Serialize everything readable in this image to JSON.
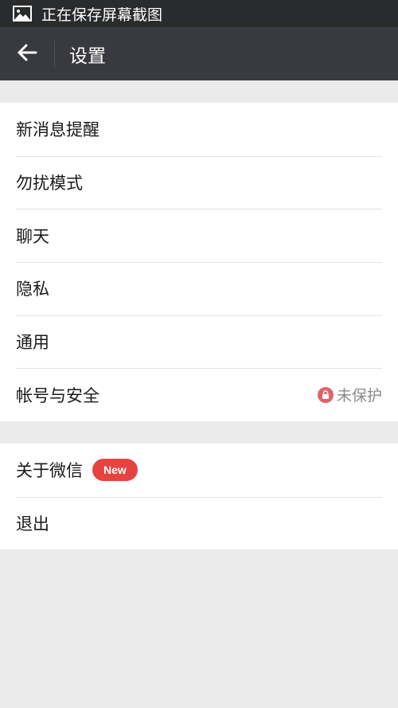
{
  "status_bar": {
    "icon": "image-icon",
    "text": "正在保存屏幕截图"
  },
  "title_bar": {
    "back_icon": "arrow-left-icon",
    "title": "设置"
  },
  "groups": [
    {
      "items": [
        {
          "label": "新消息提醒"
        },
        {
          "label": "勿扰模式"
        },
        {
          "label": "聊天"
        },
        {
          "label": "隐私"
        },
        {
          "label": "通用"
        },
        {
          "label": "帐号与安全",
          "status": "未保护",
          "status_icon": "lock-icon"
        }
      ]
    },
    {
      "items": [
        {
          "label": "关于微信",
          "badge": "New"
        },
        {
          "label": "退出"
        }
      ]
    }
  ],
  "colors": {
    "status_bar_bg": "#2a2b2d",
    "title_bar_bg": "#393a3f",
    "page_bg": "#ebebeb",
    "badge_red": "#e64340",
    "lock_red": "#e0636a"
  }
}
